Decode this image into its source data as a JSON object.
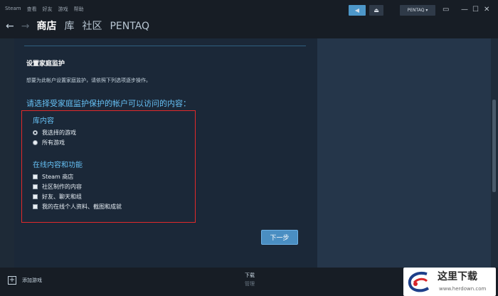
{
  "menu": [
    "Steam",
    "查看",
    "好友",
    "游戏",
    "帮助"
  ],
  "topbar": {
    "account_label": "PENTAQ ▾"
  },
  "nav": {
    "back_icon": "←",
    "forward_icon": "→",
    "items": [
      "商店",
      "库",
      "社区",
      "PENTAQ"
    ],
    "active": "商店"
  },
  "page": {
    "heading": "设置家庭监护",
    "description": "想要为此帐户设置家庭监护，请依照下列选项逐步操作。",
    "question": "请选择受家庭监护保护的帐户可以访问的内容：",
    "library": {
      "title": "库内容",
      "options": [
        "我选择的游戏",
        "所有游戏"
      ],
      "selected": "我选择的游戏"
    },
    "online": {
      "title": "在线内容和功能",
      "options": [
        "Steam 商店",
        "社区制作的内容",
        "好友、聊天和组",
        "我的在线个人资料、截图和成就"
      ]
    },
    "next_label": "下一步"
  },
  "bottom": {
    "add_game": "添加游戏",
    "download": "下载",
    "manage": "管理"
  },
  "watermark": {
    "title": "这里下载",
    "url": "www.herdown.com"
  },
  "colors": {
    "accent": "#66c0f4",
    "highlight_box": "#e22a2a",
    "button": "#4a8ec2",
    "background": "#1b2838"
  }
}
